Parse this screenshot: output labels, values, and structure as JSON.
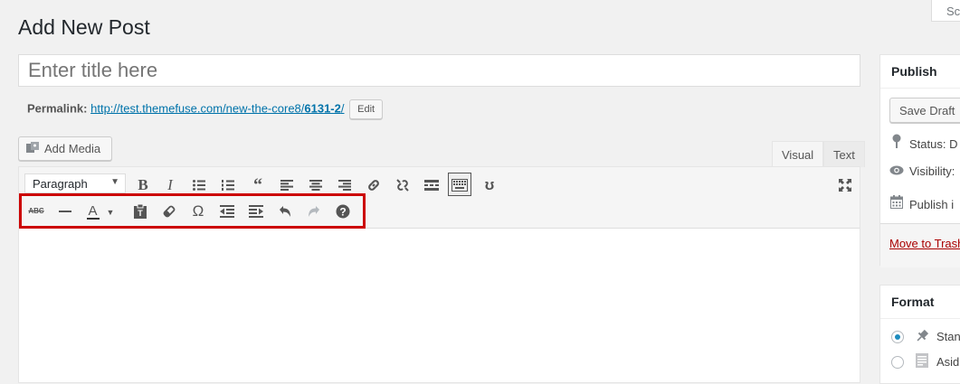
{
  "screen_options_label": "Sc",
  "page_title": "Add New Post",
  "title_placeholder": "Enter title here",
  "permalink": {
    "label": "Permalink:",
    "url_prefix": "http://test.themefuse.com/new-the-core8/",
    "url_slug": "6131-2",
    "url_suffix": "/",
    "edit_label": "Edit"
  },
  "add_media_label": "Add Media",
  "tabs": {
    "visual": "Visual",
    "text": "Text"
  },
  "format_select": {
    "selected": "Paragraph"
  },
  "toolbar_row1_icons": [
    "bold-icon",
    "italic-icon",
    "bullet-list-icon",
    "numbered-list-icon",
    "blockquote-icon",
    "align-left-icon",
    "align-center-icon",
    "align-right-icon",
    "insert-link-icon",
    "remove-link-icon",
    "read-more-icon",
    "toolbar-toggle-icon",
    "wp-icon",
    "fullscreen-icon"
  ],
  "toolbar_row2_icons": [
    "strikethrough-icon",
    "horizontal-line-icon",
    "text-color-icon",
    "paste-as-text-icon",
    "clear-formatting-icon",
    "special-character-icon",
    "outdent-icon",
    "indent-icon",
    "undo-icon",
    "redo-icon",
    "help-icon"
  ],
  "highlight_color": "#cc0000",
  "publish": {
    "heading": "Publish",
    "save_draft": "Save Draft",
    "status": "Status: D",
    "visibility": "Visibility:",
    "publish_label": "Publish i",
    "trash": "Move to Trash"
  },
  "format": {
    "heading": "Format",
    "options": [
      "Stan",
      "Asid"
    ]
  }
}
